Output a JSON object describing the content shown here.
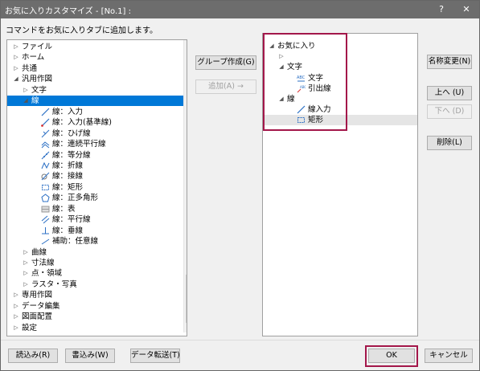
{
  "window": {
    "title": "お気に入りカスタマイズ - [No.1] :",
    "help_label": "?",
    "close_label": "✕"
  },
  "instruction": "コマンドをお気に入りタブに追加します。",
  "left_tree": {
    "items": [
      {
        "label": "ファイル",
        "expander": "▷",
        "icon": ""
      },
      {
        "label": "ホーム",
        "expander": "▷",
        "icon": ""
      },
      {
        "label": "共通",
        "expander": "▷",
        "icon": ""
      },
      {
        "label": "汎用作図",
        "expander": "◢",
        "icon": ""
      },
      {
        "label": "文字",
        "expander": "▷",
        "icon": ""
      },
      {
        "label": "線",
        "expander": "◢",
        "icon": ""
      },
      {
        "label": "線：入力",
        "expander": "",
        "icon": "line-input-icon"
      },
      {
        "label": "線：入力(基準線)",
        "expander": "",
        "icon": "line-input-base-icon"
      },
      {
        "label": "線：ひげ線",
        "expander": "",
        "icon": "whisker-line-icon"
      },
      {
        "label": "線：連続平行線",
        "expander": "",
        "icon": "continuous-parallel-line-icon"
      },
      {
        "label": "線：等分線",
        "expander": "",
        "icon": "equal-division-line-icon"
      },
      {
        "label": "線：折線",
        "expander": "",
        "icon": "polyline-icon"
      },
      {
        "label": "線：接線",
        "expander": "",
        "icon": "tangent-line-icon"
      },
      {
        "label": "線：矩形",
        "expander": "",
        "icon": "rectangle-icon"
      },
      {
        "label": "線：正多角形",
        "expander": "",
        "icon": "regular-polygon-icon"
      },
      {
        "label": "線：表",
        "expander": "",
        "icon": "table-icon"
      },
      {
        "label": "線：平行線",
        "expander": "",
        "icon": "parallel-line-icon"
      },
      {
        "label": "線：垂線",
        "expander": "",
        "icon": "perpendicular-line-icon"
      },
      {
        "label": "補助：任意線",
        "expander": "",
        "icon": "auxiliary-line-icon"
      },
      {
        "label": "曲線",
        "expander": "▷",
        "icon": ""
      },
      {
        "label": "寸法線",
        "expander": "▷",
        "icon": ""
      },
      {
        "label": "点・領域",
        "expander": "▷",
        "icon": ""
      },
      {
        "label": "ラスタ・写真",
        "expander": "▷",
        "icon": ""
      },
      {
        "label": "専用作図",
        "expander": "▷",
        "icon": ""
      },
      {
        "label": "データ編集",
        "expander": "▷",
        "icon": ""
      },
      {
        "label": "図面配置",
        "expander": "▷",
        "icon": ""
      },
      {
        "label": "設定",
        "expander": "▷",
        "icon": ""
      }
    ],
    "selected": "線"
  },
  "right_tree": {
    "items": [
      {
        "label": "お気に入り",
        "expander": "◢",
        "icon": ""
      },
      {
        "label": "",
        "expander": "▷",
        "icon": ""
      },
      {
        "label": "文字",
        "expander": "◢",
        "icon": ""
      },
      {
        "label": "文字",
        "expander": "",
        "icon": "abc-text-icon"
      },
      {
        "label": "引出線",
        "expander": "",
        "icon": "leader-line-icon"
      },
      {
        "label": "線",
        "expander": "◢",
        "icon": ""
      },
      {
        "label": "線入力",
        "expander": "",
        "icon": "line-input-icon"
      },
      {
        "label": "矩形",
        "expander": "",
        "icon": "rectangle-icon"
      }
    ]
  },
  "buttons": {
    "group_create": "グループ作成(G)",
    "add": "追加(A) →",
    "rename": "名称変更(N)",
    "up": "上へ (U)",
    "down": "下へ (D)",
    "delete": "削除(L)",
    "import": "読込み(R)",
    "export": "書込み(W)",
    "data_transfer": "データ転送(T)",
    "ok": "OK",
    "cancel": "キャンセル"
  },
  "colors": {
    "selection": "#0078d7",
    "highlight_box": "#a3174a",
    "title_bar": "#6d6d6d"
  }
}
